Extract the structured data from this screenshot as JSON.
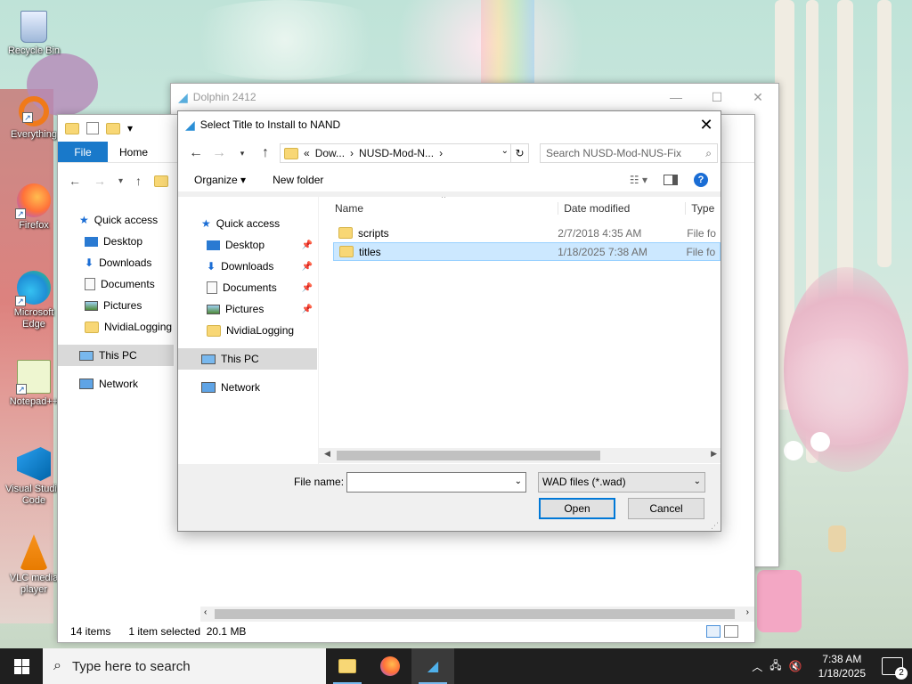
{
  "desktop": {
    "icons": [
      {
        "label": "Recycle Bin",
        "icon": "recycle-bin-icon"
      },
      {
        "label": "Everything",
        "icon": "everything-search-icon"
      },
      {
        "label": "Firefox",
        "icon": "firefox-icon"
      },
      {
        "label": "Microsoft Edge",
        "icon": "edge-icon"
      },
      {
        "label": "Notepad++",
        "icon": "notepadpp-icon"
      },
      {
        "label": "Visual Studio Code",
        "icon": "vscode-icon"
      },
      {
        "label": "VLC media player",
        "icon": "vlc-icon"
      }
    ]
  },
  "dolphin_window": {
    "title": "Dolphin 2412",
    "controls": {
      "minimize": "—",
      "maximize": "☐",
      "close": "✕"
    }
  },
  "explorer_window": {
    "ribbon": {
      "file_tab": "File",
      "home_tab": "Home"
    },
    "nav": [
      {
        "label": "Quick access",
        "icon": "star-icon",
        "level": "top"
      },
      {
        "label": "Desktop",
        "icon": "desktop-icon",
        "level": "sub"
      },
      {
        "label": "Downloads",
        "icon": "downloads-icon",
        "level": "sub"
      },
      {
        "label": "Documents",
        "icon": "documents-icon",
        "level": "sub"
      },
      {
        "label": "Pictures",
        "icon": "pictures-icon",
        "level": "sub"
      },
      {
        "label": "NvidiaLogging",
        "icon": "folder-icon",
        "level": "sub"
      },
      {
        "label": "This PC",
        "icon": "this-pc-icon",
        "level": "top"
      },
      {
        "label": "Network",
        "icon": "network-icon",
        "level": "top"
      }
    ],
    "status": {
      "items": "14 items",
      "selected": "1 item selected",
      "size": "20.1 MB"
    }
  },
  "dialog": {
    "title": "Select Title to Install to NAND",
    "close": "✕",
    "address": {
      "prefix": "«",
      "crumb1": "Dow...",
      "sep": "›",
      "crumb2": "NUSD-Mod-N...",
      "sep2": "›"
    },
    "search_placeholder": "Search NUSD-Mod-NUS-Fix",
    "toolbar": {
      "organize": "Organize ▾",
      "new_folder": "New folder"
    },
    "nav": [
      {
        "label": "Quick access",
        "icon": "star-icon",
        "level": "top",
        "pinned": false
      },
      {
        "label": "Desktop",
        "icon": "desktop-icon",
        "level": "sub",
        "pinned": true
      },
      {
        "label": "Downloads",
        "icon": "downloads-icon",
        "level": "sub",
        "pinned": true
      },
      {
        "label": "Documents",
        "icon": "documents-icon",
        "level": "sub",
        "pinned": true
      },
      {
        "label": "Pictures",
        "icon": "pictures-icon",
        "level": "sub",
        "pinned": true
      },
      {
        "label": "NvidiaLogging",
        "icon": "folder-icon",
        "level": "sub",
        "pinned": false
      },
      {
        "label": "This PC",
        "icon": "this-pc-icon",
        "level": "top",
        "pinned": false,
        "selected": true
      },
      {
        "label": "Network",
        "icon": "network-icon",
        "level": "top",
        "pinned": false
      }
    ],
    "columns": {
      "name": "Name",
      "date": "Date modified",
      "type": "Type"
    },
    "files": [
      {
        "name": "scripts",
        "date": "2/7/2018 4:35 AM",
        "type": "File fo",
        "selected": false
      },
      {
        "name": "titles",
        "date": "1/18/2025 7:38 AM",
        "type": "File fo",
        "selected": true
      }
    ],
    "file_name_label": "File name:",
    "file_name_value": "",
    "filter": "WAD files (*.wad)",
    "open_label": "Open",
    "cancel_label": "Cancel"
  },
  "taskbar": {
    "search_placeholder": "Type here to search",
    "apps": [
      {
        "name": "file-explorer",
        "icon": "file-explorer-icon",
        "running": true,
        "active": false
      },
      {
        "name": "firefox",
        "icon": "firefox-icon",
        "running": false,
        "active": false
      },
      {
        "name": "dolphin",
        "icon": "dolphin-icon",
        "running": true,
        "active": true
      }
    ],
    "time": "7:38 AM",
    "date": "1/18/2025",
    "notifications": "2"
  }
}
